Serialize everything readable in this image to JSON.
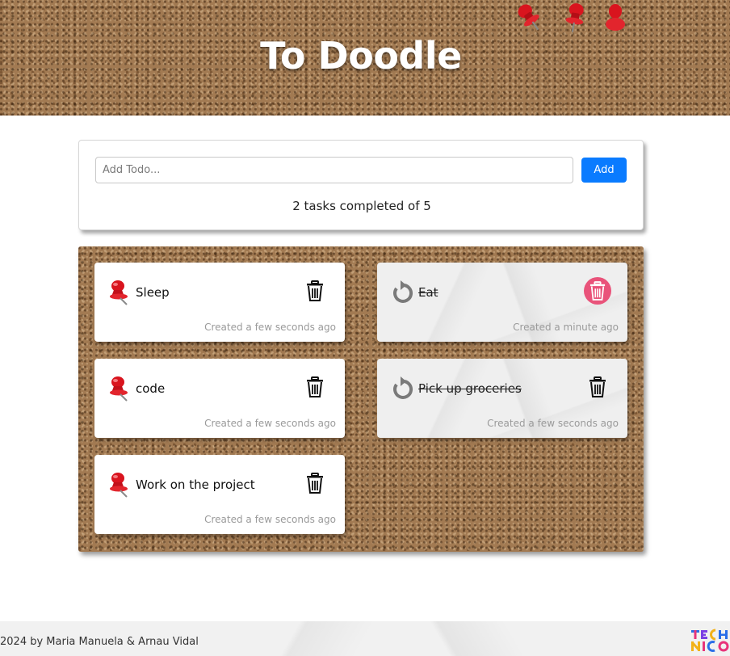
{
  "header": {
    "title": "To Doodle"
  },
  "add_form": {
    "placeholder": "Add Todo...",
    "value": "",
    "add_label": "Add",
    "completed_text": "2 tasks completed of 5"
  },
  "todos": [
    {
      "title": "Sleep",
      "time": "Created a few seconds ago",
      "completed": false
    },
    {
      "title": "Eat",
      "time": "Created a minute ago",
      "completed": true
    },
    {
      "title": "code",
      "time": "Created a few seconds ago",
      "completed": false
    },
    {
      "title": "Pick up groceries",
      "time": "Created a few seconds ago",
      "completed": true
    },
    {
      "title": "Work on the project",
      "time": "Created a few seconds ago",
      "completed": false
    }
  ],
  "footer": {
    "text": "2024 by Maria Manuela & Arnau Vidal",
    "logo_text": "TECH NICO"
  },
  "colors": {
    "accent": "#0a7bff",
    "delete_hover": "#e9537a",
    "pin_red": "#d9141e",
    "undo_gray": "#7a7a7a"
  },
  "icons": {
    "pending": "pushpin-icon",
    "completed": "undo-icon",
    "delete": "trash-icon"
  }
}
